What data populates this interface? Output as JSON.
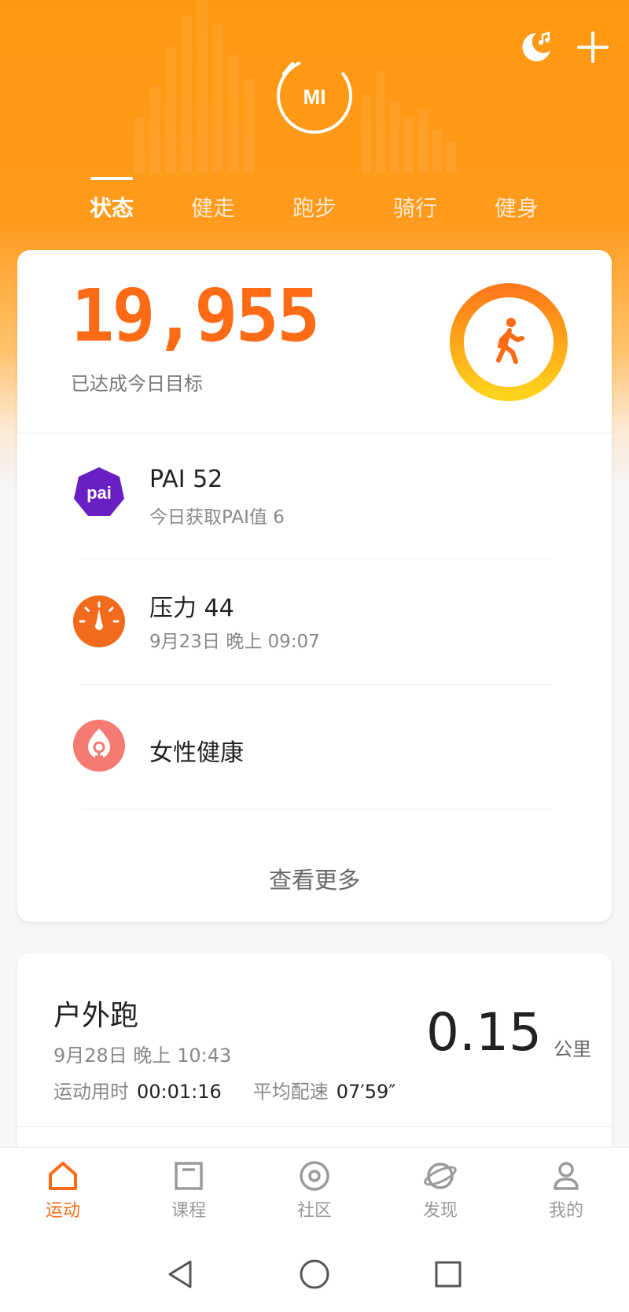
{
  "header": {
    "logo_text": "MI",
    "icons": [
      "sleep-moon-icon",
      "add-icon"
    ],
    "tabs": [
      {
        "label": "状态",
        "active": true
      },
      {
        "label": "健走",
        "active": false
      },
      {
        "label": "跑步",
        "active": false
      },
      {
        "label": "骑行",
        "active": false
      },
      {
        "label": "健身",
        "active": false
      }
    ]
  },
  "summary": {
    "steps": "19,955",
    "goal_text": "已达成今日目标",
    "ring_icon": "walking-person-icon"
  },
  "health": {
    "pai_icon_text": "pai",
    "pai_title": "PAI 52",
    "pai_sub": "今日获取PAI值 6",
    "stress_title": "压力 44",
    "stress_sub": "9月23日 晚上 09:07",
    "female_title": "女性健康",
    "more": "查看更多"
  },
  "workout": {
    "title": "户外跑",
    "time": "9月28日 晚上 10:43",
    "duration_label": "运动用时",
    "duration_value": "00:01:16",
    "pace_label": "平均配速",
    "pace_value": "07′59″",
    "distance": "0.15",
    "distance_unit": "公里"
  },
  "bottom_nav": [
    {
      "label": "运动",
      "icon": "home-icon",
      "active": true
    },
    {
      "label": "课程",
      "icon": "course-icon",
      "active": false
    },
    {
      "label": "社区",
      "icon": "community-icon",
      "active": false
    },
    {
      "label": "发现",
      "icon": "discover-icon",
      "active": false
    },
    {
      "label": "我的",
      "icon": "profile-icon",
      "active": false
    }
  ],
  "colors": {
    "brand_orange": "#ff6a14",
    "header_orange": "#ff9810",
    "pai_purple": "#6a1fc4",
    "female_pink": "#f47a72"
  }
}
